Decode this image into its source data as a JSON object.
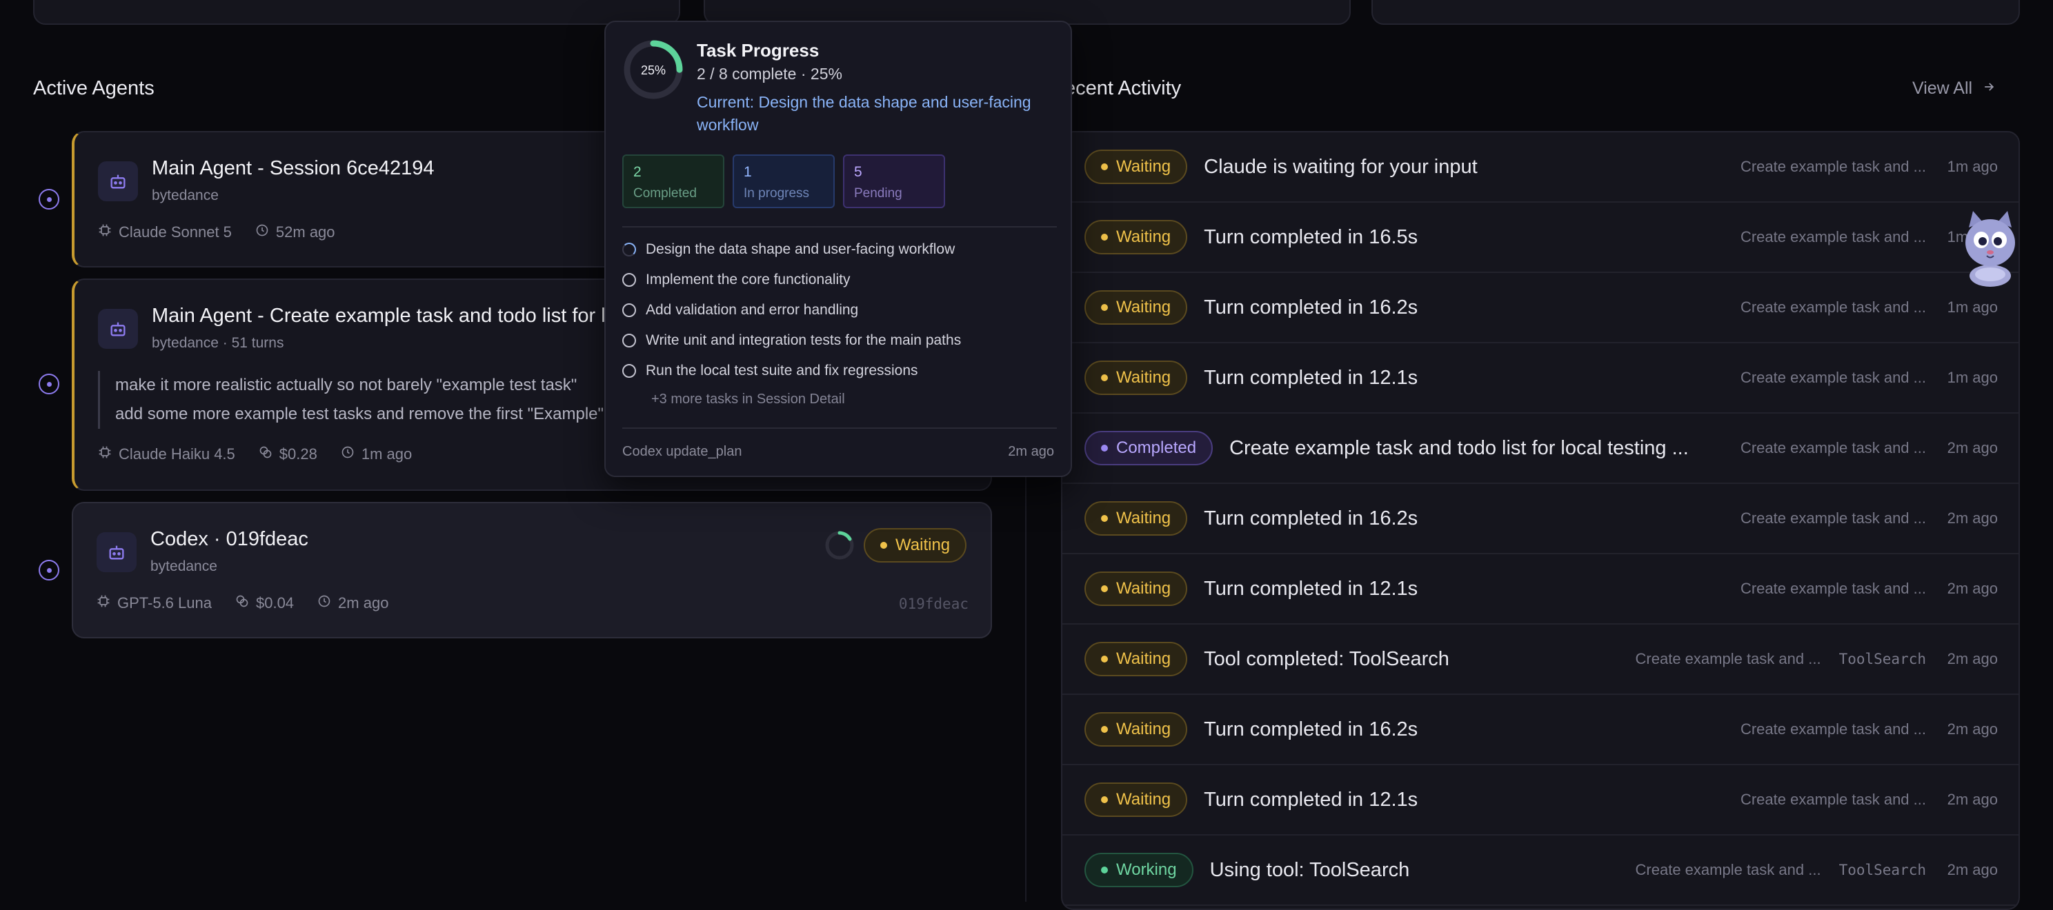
{
  "sections": {
    "active_agents": "Active Agents",
    "recent_activity": "Recent Activity",
    "view_all": "View All"
  },
  "agents": [
    {
      "title": "Main Agent - Session 6ce42194",
      "subtitle": "bytedance",
      "model": "Claude Sonnet 5",
      "time": "52m ago"
    },
    {
      "title": "Main Agent - Create example task and todo list for local testing",
      "subtitle": "bytedance · 51 turns",
      "quote_line1": "make it more realistic actually so not barely \"example test task\"",
      "quote_line2": "add some more example test tasks and remove the first \"Example\" one",
      "model": "Claude Haiku 4.5",
      "cost": "$0.28",
      "time": "1m ago"
    },
    {
      "title": "Codex · 019fdeac",
      "subtitle": "bytedance",
      "status": "Waiting",
      "model": "GPT-5.6 Luna",
      "cost": "$0.04",
      "time": "2m ago",
      "hash": "019fdeac"
    }
  ],
  "activity": [
    {
      "status": "Waiting",
      "kind": "waiting",
      "message": "Claude is waiting for your input",
      "context": "Create example task and ...",
      "tool": "",
      "time": "1m ago"
    },
    {
      "status": "Waiting",
      "kind": "waiting",
      "message": "Turn completed in 16.5s",
      "context": "Create example task and ...",
      "tool": "",
      "time": "1m ago"
    },
    {
      "status": "Waiting",
      "kind": "waiting",
      "message": "Turn completed in 16.2s",
      "context": "Create example task and ...",
      "tool": "",
      "time": "1m ago"
    },
    {
      "status": "Waiting",
      "kind": "waiting",
      "message": "Turn completed in 12.1s",
      "context": "Create example task and ...",
      "tool": "",
      "time": "1m ago"
    },
    {
      "status": "Completed",
      "kind": "completed",
      "message": "Create example task and todo list for local testing ...",
      "context": "Create example task and ...",
      "tool": "",
      "time": "2m ago"
    },
    {
      "status": "Waiting",
      "kind": "waiting",
      "message": "Turn completed in 16.2s",
      "context": "Create example task and ...",
      "tool": "",
      "time": "2m ago"
    },
    {
      "status": "Waiting",
      "kind": "waiting",
      "message": "Turn completed in 12.1s",
      "context": "Create example task and ...",
      "tool": "",
      "time": "2m ago"
    },
    {
      "status": "Waiting",
      "kind": "waiting",
      "message": "Tool completed: ToolSearch",
      "context": "Create example task and ...",
      "tool": "ToolSearch",
      "time": "2m ago"
    },
    {
      "status": "Waiting",
      "kind": "waiting",
      "message": "Turn completed in 16.2s",
      "context": "Create example task and ...",
      "tool": "",
      "time": "2m ago"
    },
    {
      "status": "Waiting",
      "kind": "waiting",
      "message": "Turn completed in 12.1s",
      "context": "Create example task and ...",
      "tool": "",
      "time": "2m ago"
    },
    {
      "status": "Working",
      "kind": "working",
      "message": "Using tool: ToolSearch",
      "context": "Create example task and ...",
      "tool": "ToolSearch",
      "time": "2m ago"
    }
  ],
  "task_popover": {
    "percent_label": "25%",
    "progress_fraction": 0.25,
    "title": "Task Progress",
    "summary": "2 / 8 complete · 25%",
    "current": "Current: Design the data shape and user-facing workflow",
    "counts": {
      "completed_n": "2",
      "completed_label": "Completed",
      "progress_n": "1",
      "progress_label": "In progress",
      "pending_n": "5",
      "pending_label": "Pending"
    },
    "tasks": [
      "Design the data shape and user-facing workflow",
      "Implement the core functionality",
      "Add validation and error handling",
      "Write unit and integration tests for the main paths",
      "Run the local test suite and fix regressions"
    ],
    "more": "+3 more tasks in Session Detail",
    "footer_left": "Codex update_plan",
    "footer_right": "2m ago"
  },
  "colors": {
    "accent_purple": "#8e7cf0",
    "waiting": "#f0c24a",
    "completed": "#9d8af5",
    "working": "#5dd39a",
    "link": "#8ab4f8"
  }
}
